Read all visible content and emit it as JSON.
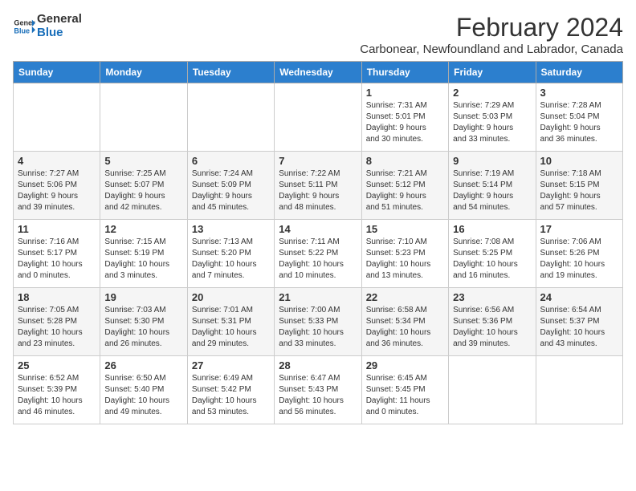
{
  "logo": {
    "line1": "General",
    "line2": "Blue"
  },
  "title": "February 2024",
  "subtitle": "Carbonear, Newfoundland and Labrador, Canada",
  "headers": [
    "Sunday",
    "Monday",
    "Tuesday",
    "Wednesday",
    "Thursday",
    "Friday",
    "Saturday"
  ],
  "weeks": [
    [
      {
        "day": "",
        "info": ""
      },
      {
        "day": "",
        "info": ""
      },
      {
        "day": "",
        "info": ""
      },
      {
        "day": "",
        "info": ""
      },
      {
        "day": "1",
        "info": "Sunrise: 7:31 AM\nSunset: 5:01 PM\nDaylight: 9 hours\nand 30 minutes."
      },
      {
        "day": "2",
        "info": "Sunrise: 7:29 AM\nSunset: 5:03 PM\nDaylight: 9 hours\nand 33 minutes."
      },
      {
        "day": "3",
        "info": "Sunrise: 7:28 AM\nSunset: 5:04 PM\nDaylight: 9 hours\nand 36 minutes."
      }
    ],
    [
      {
        "day": "4",
        "info": "Sunrise: 7:27 AM\nSunset: 5:06 PM\nDaylight: 9 hours\nand 39 minutes."
      },
      {
        "day": "5",
        "info": "Sunrise: 7:25 AM\nSunset: 5:07 PM\nDaylight: 9 hours\nand 42 minutes."
      },
      {
        "day": "6",
        "info": "Sunrise: 7:24 AM\nSunset: 5:09 PM\nDaylight: 9 hours\nand 45 minutes."
      },
      {
        "day": "7",
        "info": "Sunrise: 7:22 AM\nSunset: 5:11 PM\nDaylight: 9 hours\nand 48 minutes."
      },
      {
        "day": "8",
        "info": "Sunrise: 7:21 AM\nSunset: 5:12 PM\nDaylight: 9 hours\nand 51 minutes."
      },
      {
        "day": "9",
        "info": "Sunrise: 7:19 AM\nSunset: 5:14 PM\nDaylight: 9 hours\nand 54 minutes."
      },
      {
        "day": "10",
        "info": "Sunrise: 7:18 AM\nSunset: 5:15 PM\nDaylight: 9 hours\nand 57 minutes."
      }
    ],
    [
      {
        "day": "11",
        "info": "Sunrise: 7:16 AM\nSunset: 5:17 PM\nDaylight: 10 hours\nand 0 minutes."
      },
      {
        "day": "12",
        "info": "Sunrise: 7:15 AM\nSunset: 5:19 PM\nDaylight: 10 hours\nand 3 minutes."
      },
      {
        "day": "13",
        "info": "Sunrise: 7:13 AM\nSunset: 5:20 PM\nDaylight: 10 hours\nand 7 minutes."
      },
      {
        "day": "14",
        "info": "Sunrise: 7:11 AM\nSunset: 5:22 PM\nDaylight: 10 hours\nand 10 minutes."
      },
      {
        "day": "15",
        "info": "Sunrise: 7:10 AM\nSunset: 5:23 PM\nDaylight: 10 hours\nand 13 minutes."
      },
      {
        "day": "16",
        "info": "Sunrise: 7:08 AM\nSunset: 5:25 PM\nDaylight: 10 hours\nand 16 minutes."
      },
      {
        "day": "17",
        "info": "Sunrise: 7:06 AM\nSunset: 5:26 PM\nDaylight: 10 hours\nand 19 minutes."
      }
    ],
    [
      {
        "day": "18",
        "info": "Sunrise: 7:05 AM\nSunset: 5:28 PM\nDaylight: 10 hours\nand 23 minutes."
      },
      {
        "day": "19",
        "info": "Sunrise: 7:03 AM\nSunset: 5:30 PM\nDaylight: 10 hours\nand 26 minutes."
      },
      {
        "day": "20",
        "info": "Sunrise: 7:01 AM\nSunset: 5:31 PM\nDaylight: 10 hours\nand 29 minutes."
      },
      {
        "day": "21",
        "info": "Sunrise: 7:00 AM\nSunset: 5:33 PM\nDaylight: 10 hours\nand 33 minutes."
      },
      {
        "day": "22",
        "info": "Sunrise: 6:58 AM\nSunset: 5:34 PM\nDaylight: 10 hours\nand 36 minutes."
      },
      {
        "day": "23",
        "info": "Sunrise: 6:56 AM\nSunset: 5:36 PM\nDaylight: 10 hours\nand 39 minutes."
      },
      {
        "day": "24",
        "info": "Sunrise: 6:54 AM\nSunset: 5:37 PM\nDaylight: 10 hours\nand 43 minutes."
      }
    ],
    [
      {
        "day": "25",
        "info": "Sunrise: 6:52 AM\nSunset: 5:39 PM\nDaylight: 10 hours\nand 46 minutes."
      },
      {
        "day": "26",
        "info": "Sunrise: 6:50 AM\nSunset: 5:40 PM\nDaylight: 10 hours\nand 49 minutes."
      },
      {
        "day": "27",
        "info": "Sunrise: 6:49 AM\nSunset: 5:42 PM\nDaylight: 10 hours\nand 53 minutes."
      },
      {
        "day": "28",
        "info": "Sunrise: 6:47 AM\nSunset: 5:43 PM\nDaylight: 10 hours\nand 56 minutes."
      },
      {
        "day": "29",
        "info": "Sunrise: 6:45 AM\nSunset: 5:45 PM\nDaylight: 11 hours\nand 0 minutes."
      },
      {
        "day": "",
        "info": ""
      },
      {
        "day": "",
        "info": ""
      }
    ]
  ]
}
